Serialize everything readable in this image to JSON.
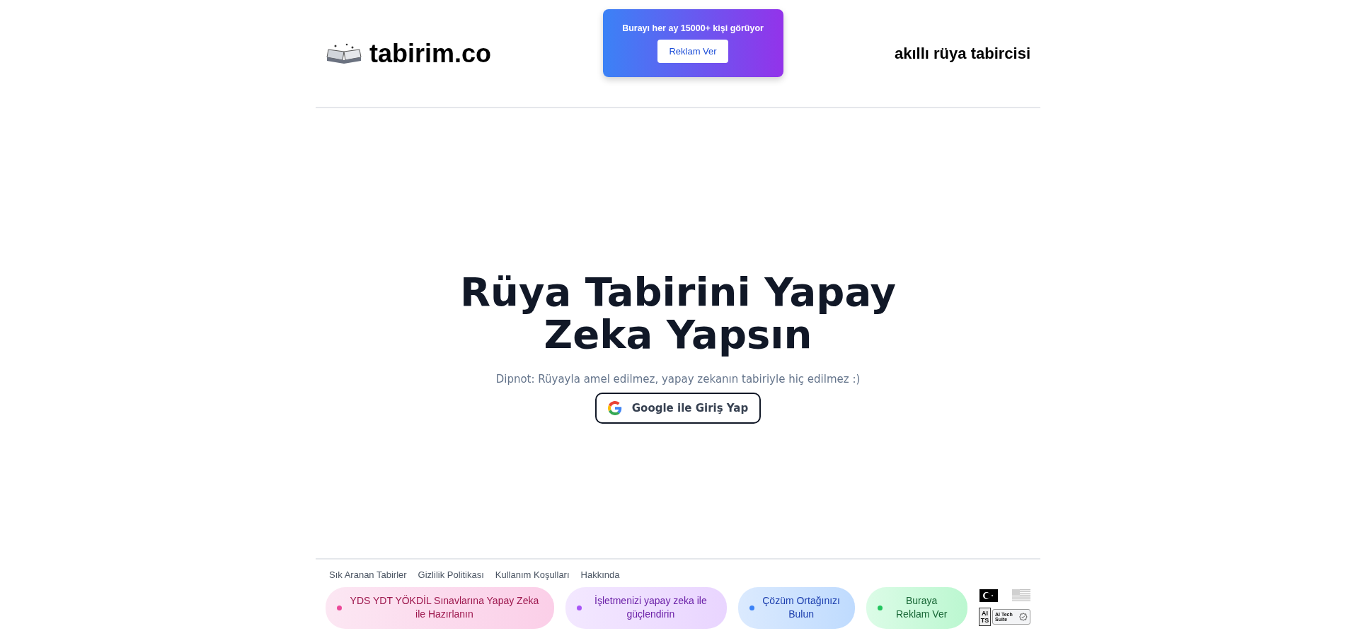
{
  "header": {
    "logo": "tabirim.co",
    "ad": {
      "text": "Burayı her ay 15000+ kişi görüyor",
      "button": "Reklam Ver"
    },
    "tagline": "akıllı rüya tabircisi"
  },
  "hero": {
    "title": "Rüya Tabirini Yapay Zeka Yapsın",
    "note": "Dipnot: Rüyayla amel edilmez, yapay zekanın tabiriyle hiç edilmez :)",
    "login_button": "Google ile Giriş Yap"
  },
  "footer": {
    "links": [
      "Sık Aranan Tabirler",
      "Gizlilik Politikası",
      "Kullanım Koşulları",
      "Hakkında"
    ],
    "promos": [
      {
        "text": "YDS YDT YÖKDİL Sınavlarına Yapay Zeka ile Hazırlanın",
        "color": "#ec4899"
      },
      {
        "text": "İşletmenizi yapay zeka ile güçlendirin",
        "color": "#a855f7"
      },
      {
        "text": "Çözüm Ortağınızı Bulun",
        "color": "#3b82f6"
      },
      {
        "text": "Buraya Reklam Ver",
        "color": "#22c55e"
      }
    ],
    "languages": [
      {
        "kind": "tr",
        "selected": true
      },
      {
        "kind": "us",
        "selected": false
      }
    ],
    "badges": [
      {
        "kind": "monogram",
        "lines": [
          "AI",
          "TS"
        ]
      },
      {
        "kind": "verified",
        "text": "AI Tech Suite"
      }
    ]
  }
}
